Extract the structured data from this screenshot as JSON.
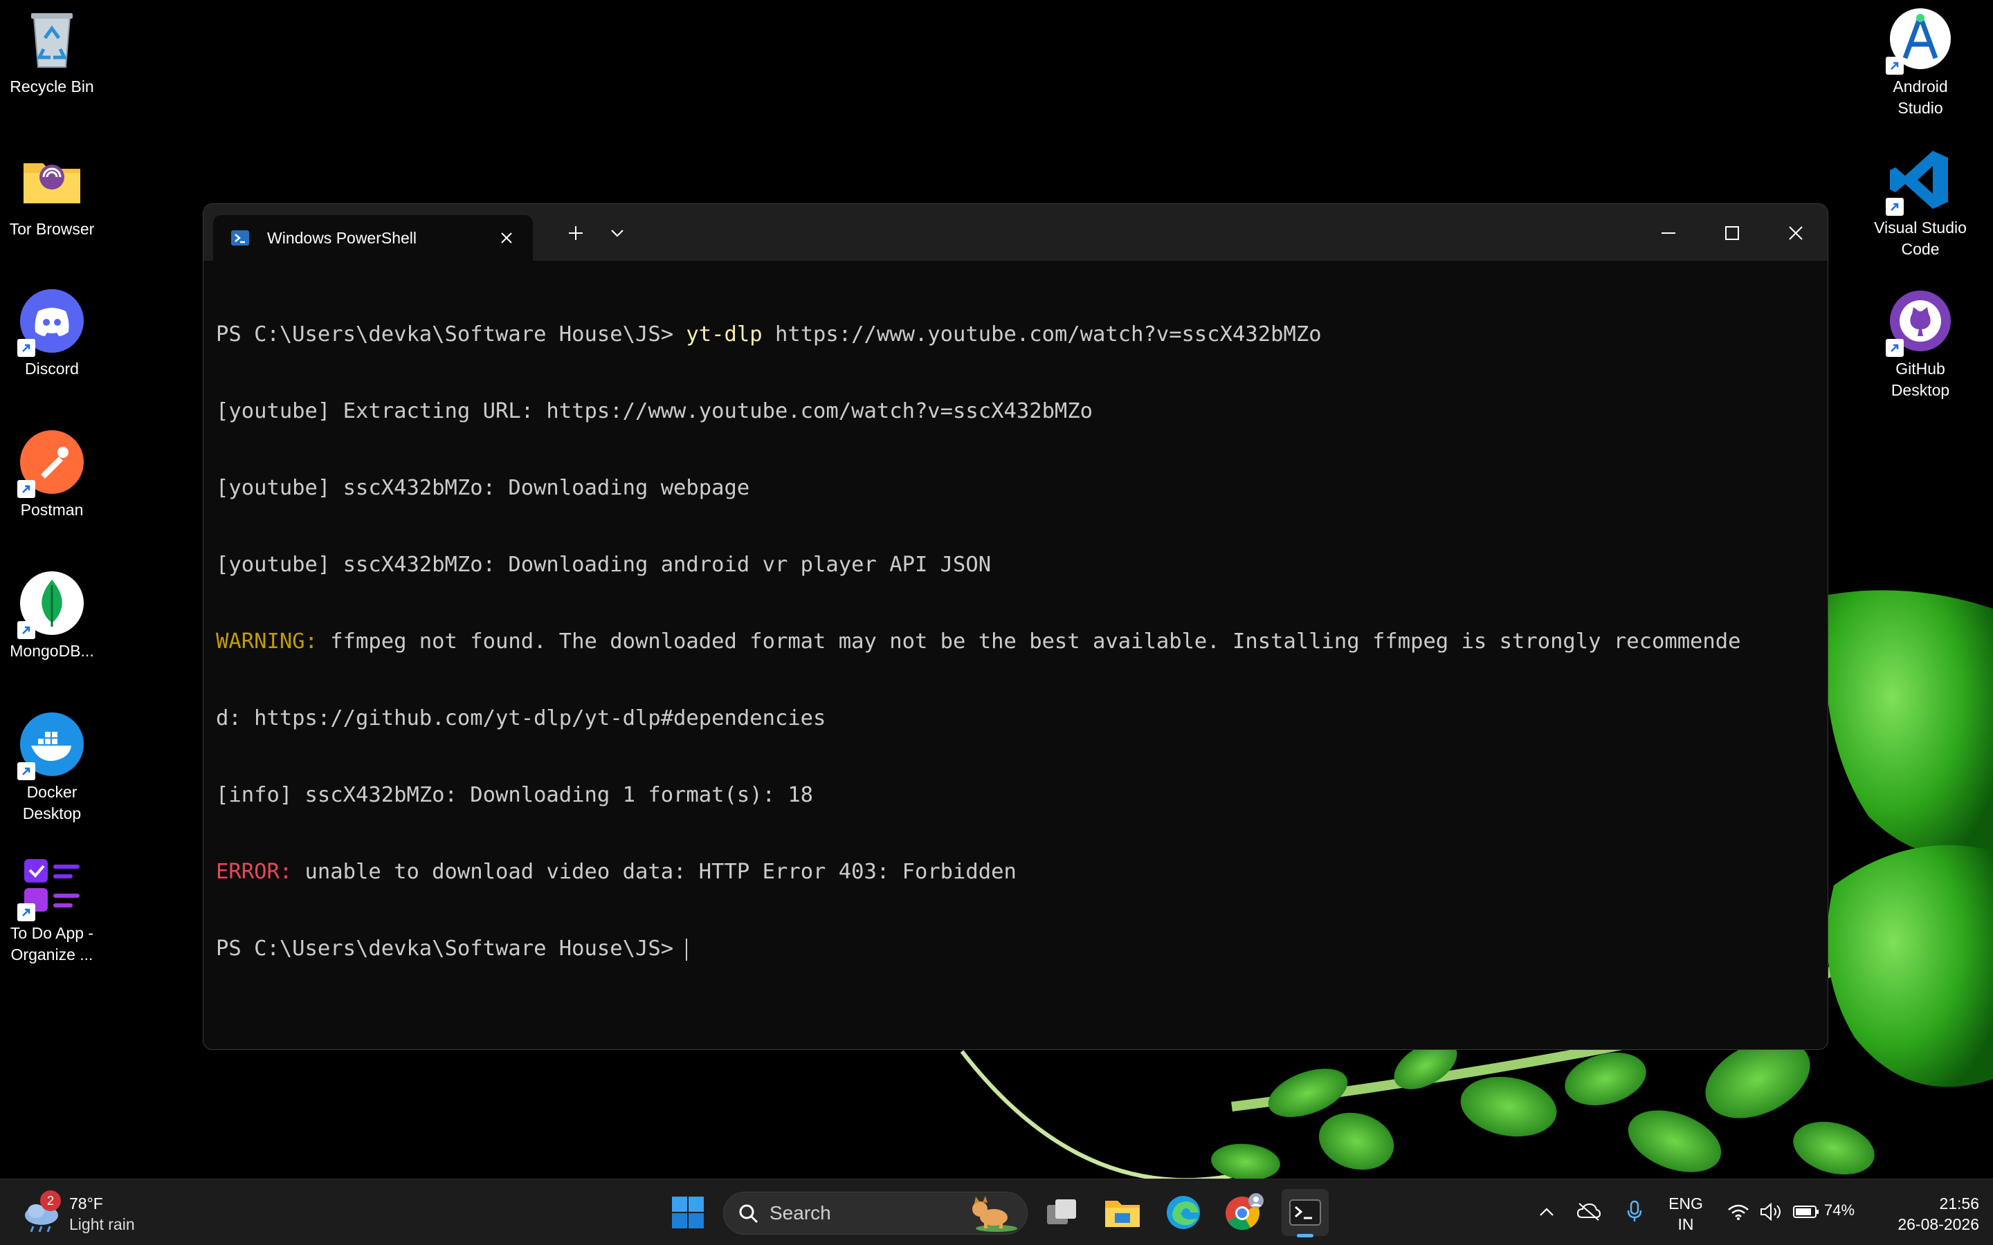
{
  "desktop": {
    "icons_left": [
      {
        "name": "recycle-bin",
        "label": "Recycle Bin"
      },
      {
        "name": "tor-browser",
        "label": "Tor Browser"
      },
      {
        "name": "discord",
        "label": "Discord"
      },
      {
        "name": "postman",
        "label": "Postman"
      },
      {
        "name": "mongodb",
        "label": "MongoDB..."
      },
      {
        "name": "docker-desktop",
        "label_line1": "Docker",
        "label_line2": "Desktop"
      },
      {
        "name": "todo-app",
        "label_line1": "To Do App -",
        "label_line2": "Organize ..."
      }
    ],
    "icons_right": [
      {
        "name": "android-studio",
        "label_line1": "Android",
        "label_line2": "Studio"
      },
      {
        "name": "vscode",
        "label_line1": "Visual Studio",
        "label_line2": "Code"
      },
      {
        "name": "github-desktop",
        "label_line1": "GitHub",
        "label_line2": "Desktop"
      }
    ]
  },
  "terminal": {
    "tab_title": "Windows PowerShell",
    "lines": {
      "l1_prompt": "PS C:\\Users\\devka\\Software House\\JS> ",
      "l1_cmd": "yt-dlp",
      "l1_args": " https://www.youtube.com/watch?v=sscX432bMZo",
      "l2": "[youtube] Extracting URL: https://www.youtube.com/watch?v=sscX432bMZo",
      "l3": "[youtube] sscX432bMZo: Downloading webpage",
      "l4": "[youtube] sscX432bMZo: Downloading android vr player API JSON",
      "l5_tag": "WARNING:",
      "l5_text": " ffmpeg not found. The downloaded format may not be the best available. Installing ffmpeg is strongly recommende",
      "l6": "d: https://github.com/yt-dlp/yt-dlp#dependencies",
      "l7": "[info] sscX432bMZo: Downloading 1 format(s): 18",
      "l8_tag": "ERROR:",
      "l8_text": " unable to download video data: HTTP Error 403: Forbidden",
      "l9_prompt": "PS C:\\Users\\devka\\Software House\\JS> "
    },
    "colors": {
      "command": "#f9f1a5",
      "warning": "#c19c00",
      "error": "#e74856",
      "text": "#cccccc"
    }
  },
  "taskbar": {
    "weather": {
      "temp": "78°F",
      "condition": "Light rain",
      "badge": "2"
    },
    "search_label": "Search",
    "language": {
      "line1": "ENG",
      "line2": "IN"
    },
    "battery": "74%",
    "clock": {
      "time": "21:56",
      "date": "26-08-2026"
    }
  }
}
